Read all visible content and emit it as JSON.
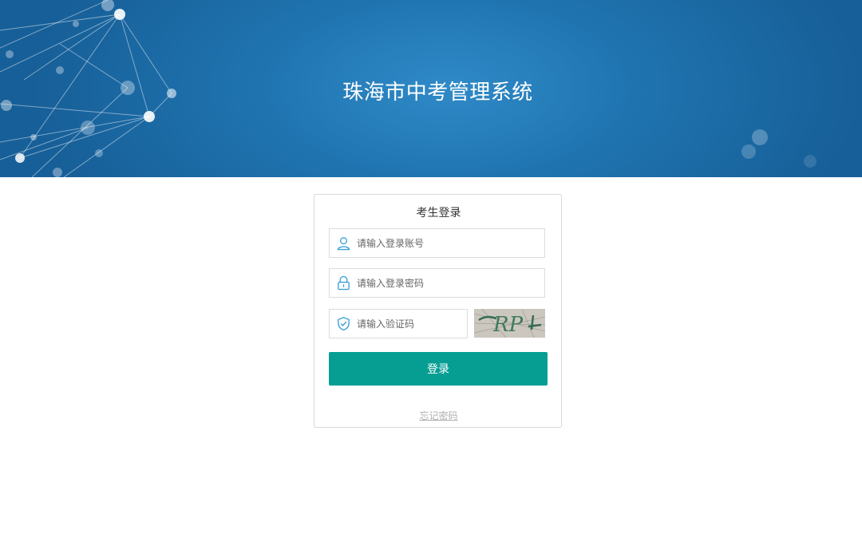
{
  "header": {
    "title": "珠海市中考管理系统"
  },
  "login": {
    "title": "考生登录",
    "account_placeholder": "请输入登录账号",
    "password_placeholder": "请输入登录密码",
    "captcha_placeholder": "请输入验证码",
    "captcha_text": "RP",
    "submit_label": "登录",
    "forgot_label": "忘记密码"
  },
  "colors": {
    "banner": "#1f74b0",
    "accent": "#069e93",
    "icon": "#3a9fd6"
  },
  "icons": {
    "account": "user-icon",
    "password": "lock-icon",
    "captcha": "shield-check-icon"
  }
}
